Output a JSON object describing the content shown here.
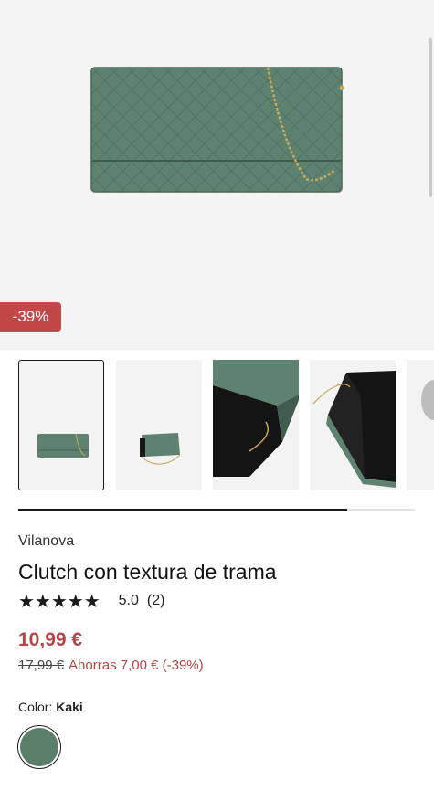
{
  "hero": {
    "discount_badge": "-39%"
  },
  "gallery": {
    "thumbnails": [
      {
        "name": "thumbnail-1-front",
        "selected": true
      },
      {
        "name": "thumbnail-2-angle",
        "selected": false
      },
      {
        "name": "thumbnail-3-detail",
        "selected": false
      },
      {
        "name": "thumbnail-4-open",
        "selected": false
      },
      {
        "name": "thumbnail-5-partial",
        "selected": false
      }
    ],
    "progress": 0.83
  },
  "product": {
    "brand": "Vilanova",
    "title": "Clutch con textura de trama",
    "stars": "★★★★★",
    "rating": "5.0",
    "review_count": "(2)",
    "price": "10,99 €",
    "old_price": "17,99 €",
    "savings": "Ahorras 7,00 € (-39%)",
    "color_label": "Color:",
    "color_value": "Kaki",
    "swatch_color": "#5b7f69"
  },
  "colors": {
    "accent_red": "#b94343",
    "badge_red": "#c24848",
    "bag_green": "#5b7f69"
  }
}
